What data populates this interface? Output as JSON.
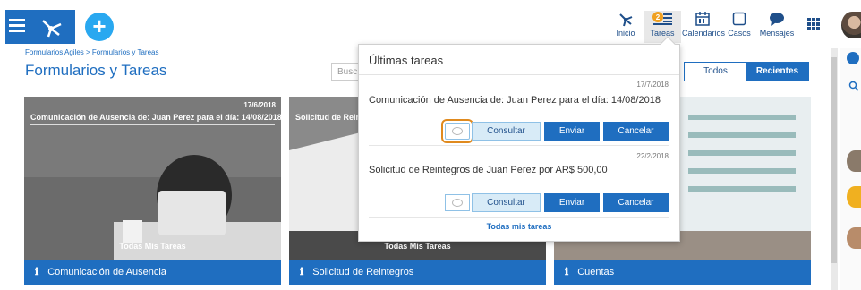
{
  "topbar": {
    "nav": [
      {
        "label": "Inicio",
        "icon": "home-network-icon"
      },
      {
        "label": "Tareas",
        "icon": "tasks-icon",
        "badge": "2"
      },
      {
        "label": "Calendarios",
        "icon": "calendar-icon"
      },
      {
        "label": "Casos",
        "icon": "cases-icon"
      },
      {
        "label": "Mensajes",
        "icon": "chat-icon"
      }
    ],
    "add_icon": "+"
  },
  "breadcrumb": "Formularios Agiles > Formularios y Tareas",
  "page_title": "Formularios y Tareas",
  "search_placeholder": "Busc",
  "filters": {
    "all": "Todos",
    "recent": "Recientes"
  },
  "cards": [
    {
      "date": "17/6/2018",
      "subject": "Comunicación de Ausencia de: Juan Perez para el día: 14/08/2018",
      "tasks_link": "Todas Mis Tareas",
      "footer": "Comunicación de Ausencia"
    },
    {
      "subject": "Solicitud de Rein",
      "tasks_link": "Todas Mis Tareas",
      "footer": "Solicitud de Reintegros"
    },
    {
      "footer": "Cuentas"
    }
  ],
  "popover": {
    "title": "Últimas tareas",
    "tasks": [
      {
        "date": "17/7/2018",
        "text": "Comunicación de Ausencia de: Juan Perez para el día: 14/08/2018"
      },
      {
        "date": "22/2/2018",
        "text": "Solicitud de Reintegros de Juan  Perez por  AR$  500,00"
      }
    ],
    "buttons": {
      "consult": "Consultar",
      "send": "Enviar",
      "cancel": "Cancelar"
    },
    "all_tasks": "Todas mis tareas"
  },
  "colors": {
    "brand": "#1f6ec0",
    "accent": "#29a8f0",
    "highlight": "#e08a1e",
    "badge": "#f0a020"
  }
}
